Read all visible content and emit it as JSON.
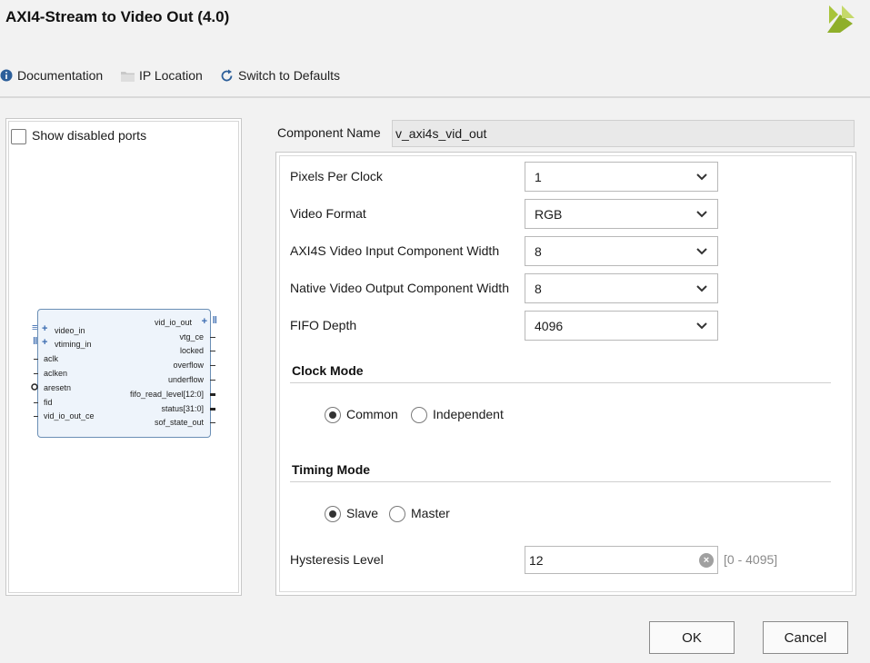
{
  "window": {
    "title": "AXI4-Stream to Video Out (4.0)"
  },
  "toolbar": {
    "documentation": "Documentation",
    "ip_location": "IP Location",
    "switch_defaults": "Switch to Defaults"
  },
  "left": {
    "show_disabled_ports": "Show disabled ports",
    "block": {
      "left_ports": [
        "video_in",
        "vtiming_in",
        "aclk",
        "aclken",
        "aresetn",
        "fid",
        "vid_io_out_ce"
      ],
      "right_ports": [
        "vid_io_out",
        "vtg_ce",
        "locked",
        "overflow",
        "underflow",
        "fifo_read_level[12:0]",
        "status[31:0]",
        "sof_state_out"
      ]
    }
  },
  "right": {
    "component_name_label": "Component Name",
    "component_name_value": "v_axi4s_vid_out",
    "params": [
      {
        "label": "Pixels Per Clock",
        "value": "1"
      },
      {
        "label": "Video Format",
        "value": "RGB"
      },
      {
        "label": "AXI4S Video Input Component Width",
        "value": "8"
      },
      {
        "label": "Native Video Output Component Width",
        "value": "8"
      },
      {
        "label": "FIFO Depth",
        "value": "4096"
      }
    ],
    "clock_mode": {
      "title": "Clock Mode",
      "options": [
        "Common",
        "Independent"
      ],
      "selected": "Common"
    },
    "timing_mode": {
      "title": "Timing Mode",
      "options": [
        "Slave",
        "Master"
      ],
      "selected": "Slave"
    },
    "hysteresis": {
      "label": "Hysteresis Level",
      "value": "12",
      "range": "[0 - 4095]"
    }
  },
  "buttons": {
    "ok": "OK",
    "cancel": "Cancel"
  },
  "colors": {
    "logo": "#a8c43a",
    "block_border": "#6b8fb5",
    "info_icon": "#2d5f9a"
  }
}
